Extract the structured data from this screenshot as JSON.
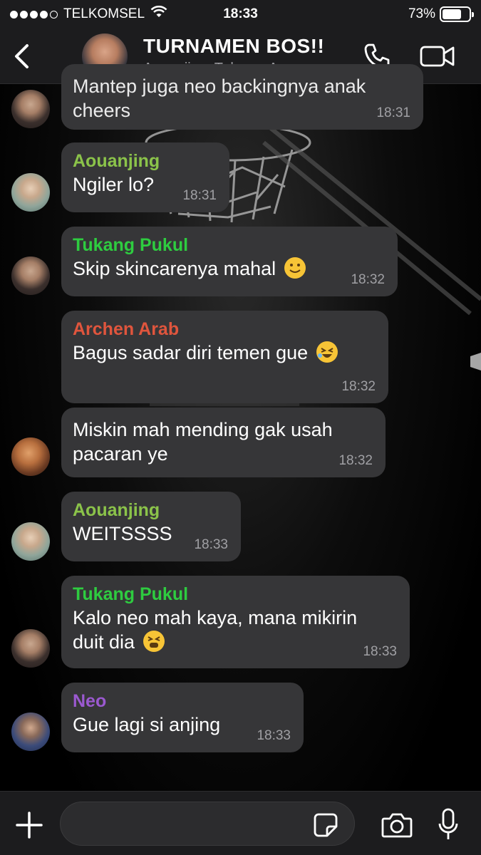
{
  "status_bar": {
    "carrier": "TELKOMSEL",
    "time": "18:33",
    "battery": "73%",
    "battery_level": 0.73
  },
  "header": {
    "title": "TURNAMEN BOS!!",
    "subtitle": "Aouanjing, Tukang, Ar..."
  },
  "messages": [
    {
      "sender": "",
      "text": "Mantep juga neo backingnya anak cheers",
      "time": "18:31",
      "avatar": "Tukang Pukul"
    },
    {
      "sender": "Aouanjing",
      "sender_color": "#8bc34a",
      "text": "Ngiler lo?",
      "time": "18:31"
    },
    {
      "sender": "Tukang Pukul",
      "sender_color": "#2ecc40",
      "text": "Skip skincarenya mahal",
      "emoji": "slightly-smiling-face",
      "time": "18:32"
    },
    {
      "sender": "Archen Arab",
      "sender_color": "#e0553d",
      "text": "Bagus sadar diri temen gue",
      "emoji": "rolling-on-floor-laughing",
      "time": "18:32"
    },
    {
      "sender": "",
      "text_line1": "Miskin mah mending gak usah",
      "text_line2": "pacaran ye",
      "time": "18:32",
      "avatar": "Archen Arab"
    },
    {
      "sender": "Aouanjing",
      "sender_color": "#8bc34a",
      "text": "WEITSSSS",
      "time": "18:33"
    },
    {
      "sender": "Tukang Pukul",
      "sender_color": "#2ecc40",
      "text_line1": "Kalo neo mah kaya, mana mikirin",
      "text_line2": "duit dia",
      "emoji": "tired-face",
      "time": "18:33"
    },
    {
      "sender": "Neo",
      "sender_color": "#9b59d0",
      "text": "Gue lagi si anjing",
      "time": "18:33"
    }
  ],
  "composer": {
    "placeholder": ""
  },
  "colors": {
    "bubble": "#363638",
    "bar": "#1c1c1e",
    "timestamp": "#a0a0a4"
  }
}
